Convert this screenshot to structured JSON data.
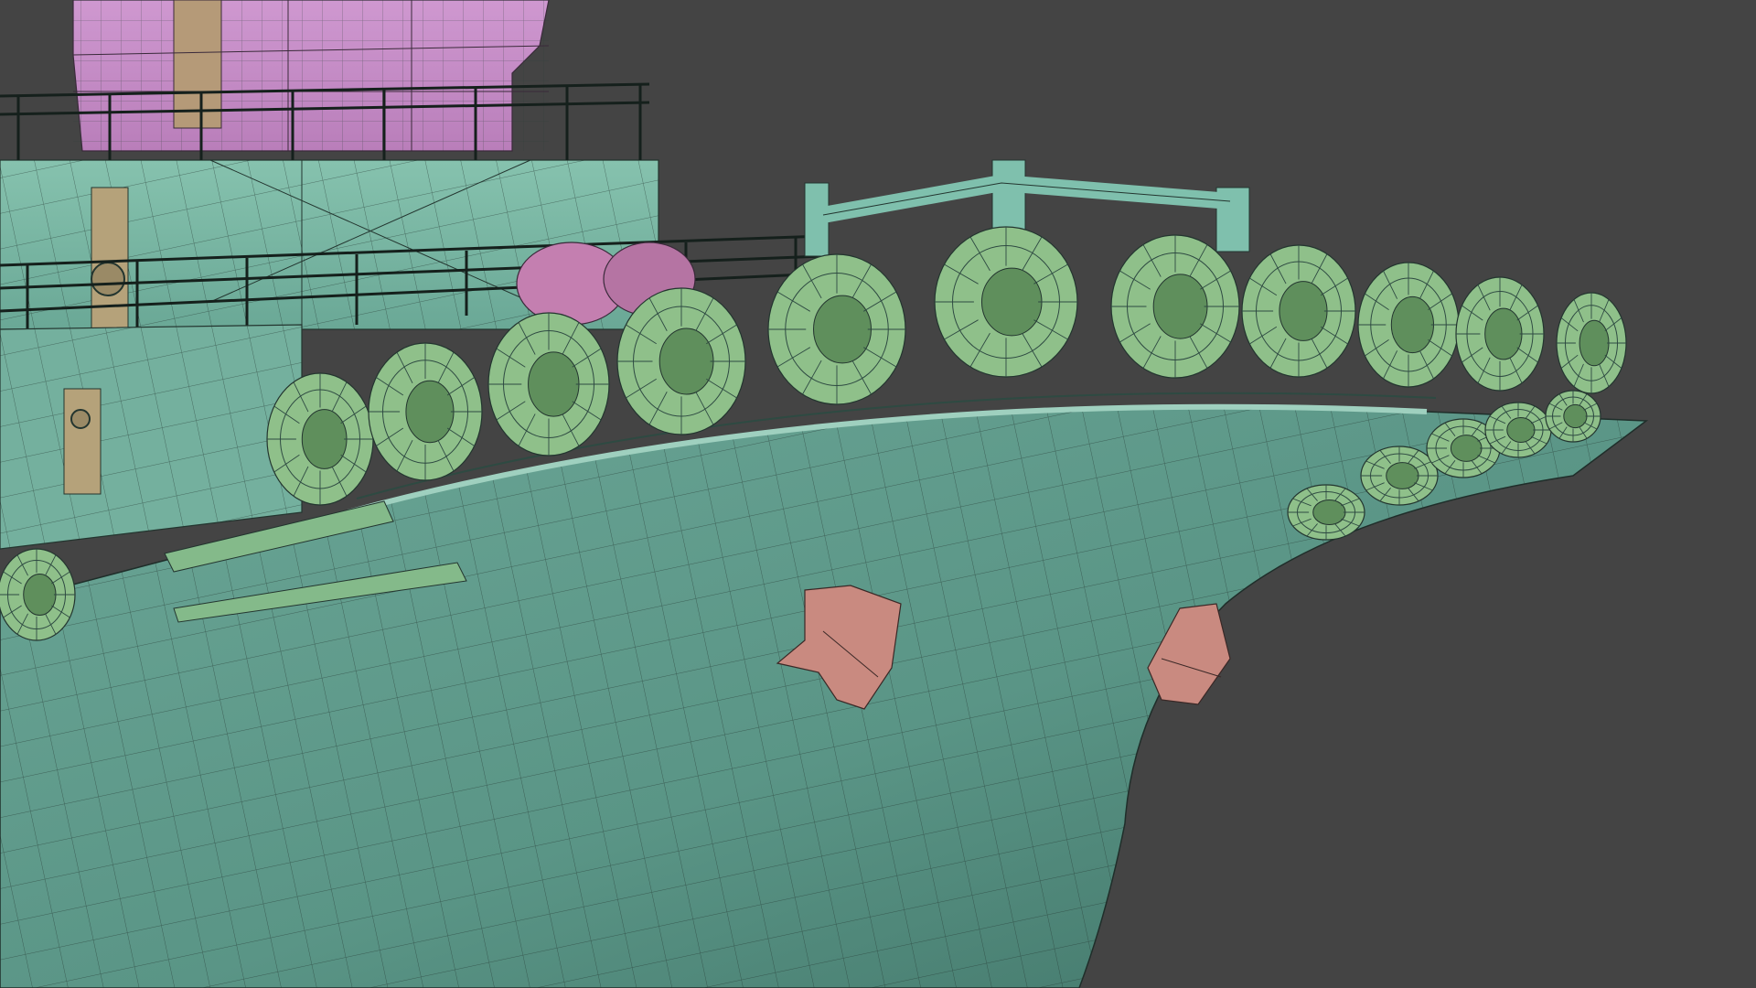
{
  "scene": {
    "viewport_background": "#444444",
    "subject": "tugboat-bow-wireframe",
    "materials": {
      "hull": "#5f9a8c",
      "hull_dark": "#3d6b62",
      "deck": "#6faa98",
      "superstructure": "#7ab8a4",
      "wheelhouse": "#c58bc6",
      "fender": "#8fc08a",
      "fender_dark": "#5f8f5c",
      "door": "#b5a27a",
      "anchor": "#c98a80",
      "capstan": "#c47fb0",
      "wire": "#1f2e2a"
    }
  }
}
